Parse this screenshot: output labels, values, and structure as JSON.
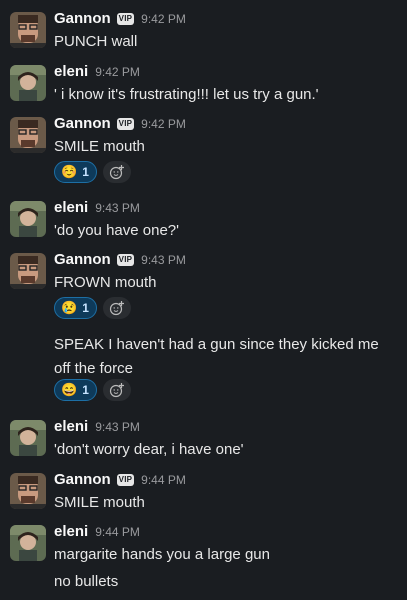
{
  "messages": [
    {
      "id": "m1",
      "author": "Gannon",
      "vip": "VIP",
      "time": "9:42 PM",
      "text": "PUNCH wall",
      "type": "gannon"
    },
    {
      "id": "m2",
      "author": "eleni",
      "time": "9:42 PM",
      "text": "' i know it's frustrating!!! let us try a gun.'",
      "type": "eleni"
    },
    {
      "id": "m3",
      "author": "Gannon",
      "vip": "VIP",
      "time": "9:42 PM",
      "text": "SMILE mouth",
      "type": "gannon",
      "reaction": {
        "emoji": "☺️",
        "count": "1"
      }
    },
    {
      "id": "m4",
      "author": "eleni",
      "time": "9:43 PM",
      "text": "'do you have one?'",
      "type": "eleni"
    },
    {
      "id": "m5",
      "author": "Gannon",
      "vip": "VIP",
      "time": "9:43 PM",
      "text": "FROWN mouth",
      "type": "gannon",
      "reaction": {
        "emoji": "😢",
        "count": "1"
      }
    },
    {
      "id": "m5b",
      "text": "SPEAK I haven't had a gun since they kicked me off the force",
      "reaction": {
        "emoji": "😄",
        "count": "1"
      }
    },
    {
      "id": "m6",
      "author": "eleni",
      "time": "9:43 PM",
      "text": "'don't worry dear, i have one'",
      "type": "eleni"
    },
    {
      "id": "m7",
      "author": "Gannon",
      "vip": "VIP",
      "time": "9:44 PM",
      "text": "SMILE mouth",
      "type": "gannon"
    },
    {
      "id": "m8",
      "author": "eleni",
      "time": "9:44 PM",
      "text": "margarite hands you a large gun",
      "type": "eleni"
    },
    {
      "id": "m8b",
      "text": "no bullets"
    }
  ]
}
